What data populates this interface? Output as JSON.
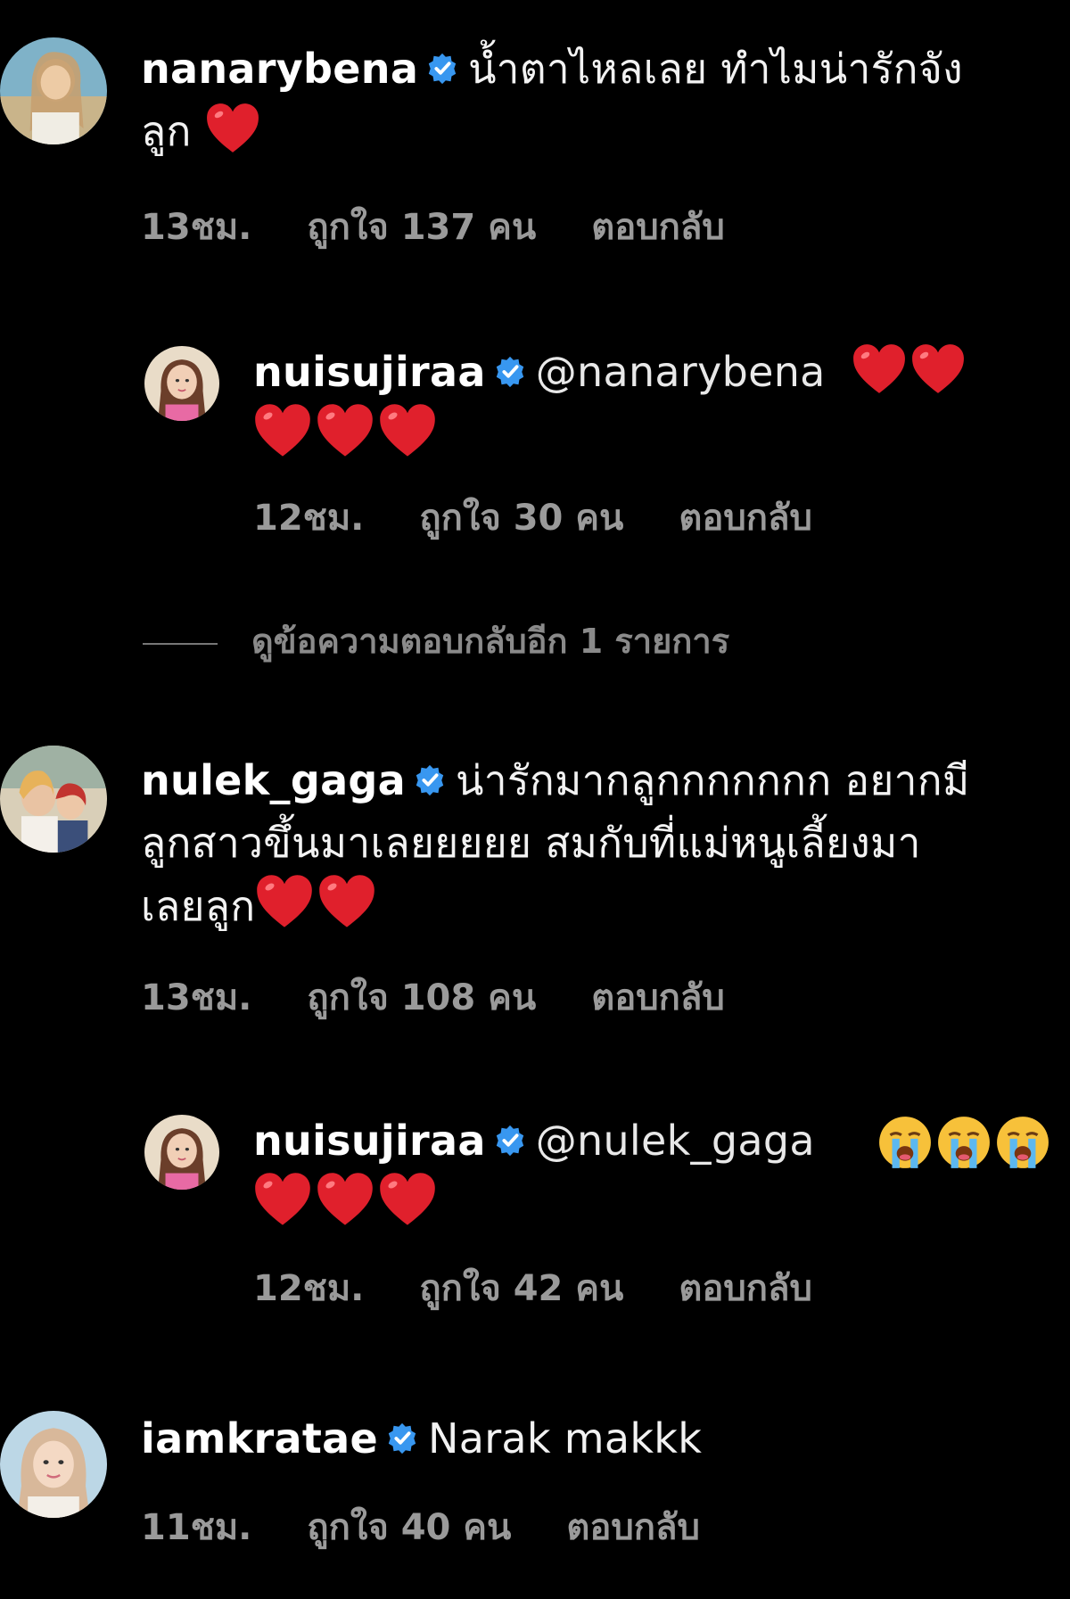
{
  "comments": [
    {
      "username": "nanarybena",
      "line1": "น้ำตาไหลเลย ทำไมน่ารักจัง",
      "line2": "ลูก",
      "time": "13ชม.",
      "likes": "ถูกใจ 137 คน",
      "reply": "ตอบกลับ"
    },
    {
      "username": "nuisujiraa",
      "mention": "@nanarybena",
      "time": "12ชม.",
      "likes": "ถูกใจ 30 คน",
      "reply": "ตอบกลับ"
    },
    {
      "username": "nulek_gaga",
      "line1": "น่ารักมากลูกกกกกกก อยากมี",
      "line2": "ลูกสาวขึ้นมาเลยยยยย สมกับที่แม่หนูเลี้ยงมา",
      "line3": "เลยลูก",
      "time": "13ชม.",
      "likes": "ถูกใจ 108 คน",
      "reply": "ตอบกลับ"
    },
    {
      "username": "nuisujiraa",
      "mention": "@nulek_gaga",
      "time": "12ชม.",
      "likes": "ถูกใจ 42 คน",
      "reply": "ตอบกลับ"
    },
    {
      "username": "iamkratae",
      "line1": "Narak makkk",
      "time": "11ชม.",
      "likes": "ถูกใจ 40 คน",
      "reply": "ตอบกลับ"
    }
  ],
  "view_more_replies": "ดูข้อความตอบกลับอีก 1 รายการ",
  "colors": {
    "background": "#000000",
    "verified_badge": "#3897f0",
    "meta_text": "#9a9a9a",
    "heart": "#e0202c"
  },
  "icons": [
    "verified-badge-icon",
    "red-heart-emoji-icon",
    "loudly-crying-emoji-icon"
  ]
}
